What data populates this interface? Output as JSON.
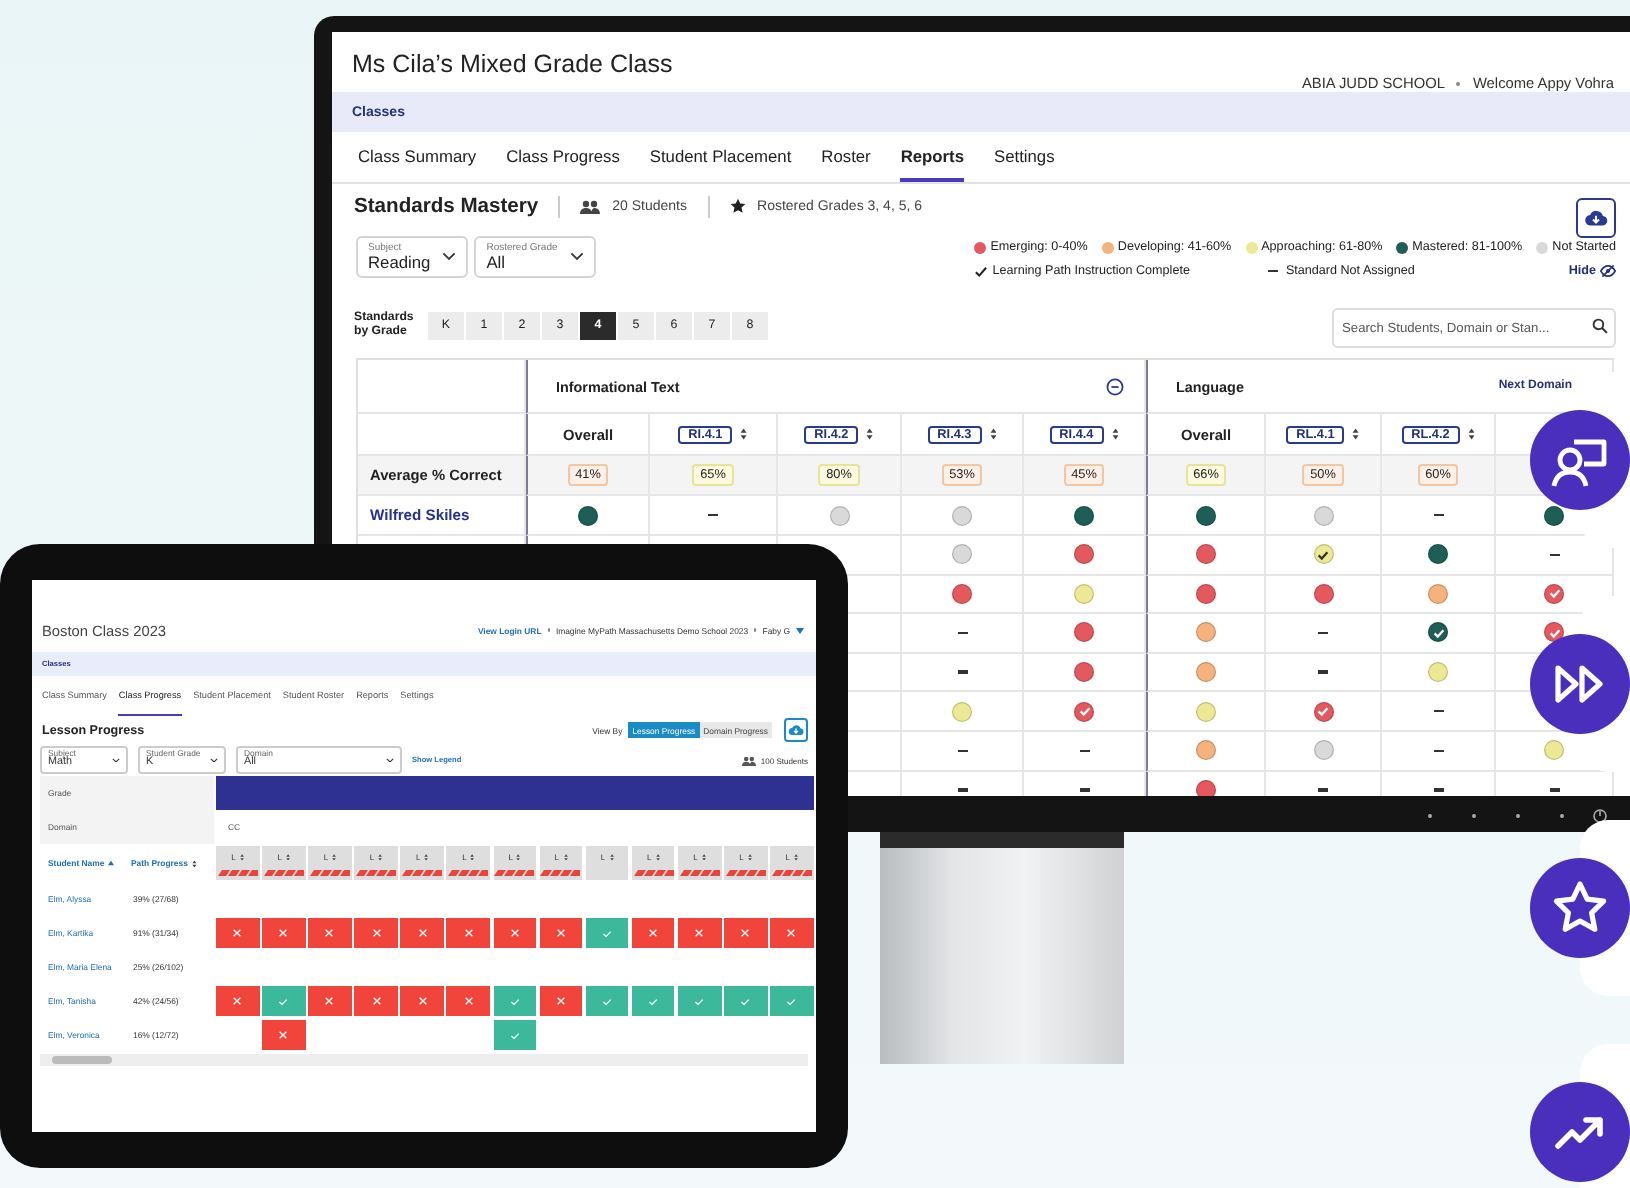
{
  "monitor": {
    "title": "Ms Cila’s Mixed Grade Class",
    "school": "ABIA JUDD SCHOOL",
    "welcome": "Welcome Appy Vohra",
    "breadcrumb": "Classes",
    "tabs": [
      {
        "label": "Class Summary",
        "selected": false
      },
      {
        "label": "Class Progress",
        "selected": false
      },
      {
        "label": "Student Placement",
        "selected": false
      },
      {
        "label": "Roster",
        "selected": false
      },
      {
        "label": "Reports",
        "selected": true
      },
      {
        "label": "Settings",
        "selected": false
      }
    ],
    "report_title": "Standards Mastery",
    "students": "20 Students",
    "rostered": "Rostered Grades 3, 4, 5, 6",
    "filters": [
      {
        "label": "Subject",
        "value": "Reading"
      },
      {
        "label": "Rostered Grade",
        "value": "All"
      }
    ],
    "legend": [
      {
        "label": "Emerging: 0-40%",
        "kind": "emerging"
      },
      {
        "label": "Developing: 41-60%",
        "kind": "developing"
      },
      {
        "label": "Approaching: 61-80%",
        "kind": "approaching"
      },
      {
        "label": "Mastered: 81-100%",
        "kind": "mastered"
      },
      {
        "label": "Not Started",
        "kind": "not_started"
      }
    ],
    "legend_notes": [
      {
        "label": "Learning Path Instruction Complete",
        "kind": "check"
      },
      {
        "label": "Standard Not Assigned",
        "kind": "dash"
      }
    ],
    "hide_link": "Hide",
    "grade_label": "Standards by Grade",
    "grades": [
      {
        "label": "K",
        "selected": false
      },
      {
        "label": "1",
        "selected": false
      },
      {
        "label": "2",
        "selected": false
      },
      {
        "label": "3",
        "selected": false
      },
      {
        "label": "4",
        "selected": true
      },
      {
        "label": "5",
        "selected": false
      },
      {
        "label": "6",
        "selected": false
      },
      {
        "label": "7",
        "selected": false
      },
      {
        "label": "8",
        "selected": false
      }
    ],
    "search": {
      "placeholder": "Search Students, Domain or Stan..."
    },
    "domains": [
      {
        "name": "Informational Text",
        "collapsible": true,
        "columns": [
          {
            "label": "Overall",
            "kind": "overall"
          },
          {
            "label": "RI.4.1",
            "kind": "standard"
          },
          {
            "label": "RI.4.2",
            "kind": "standard"
          },
          {
            "label": "RI.4.3",
            "kind": "standard"
          },
          {
            "label": "RI.4.4",
            "kind": "standard"
          }
        ]
      },
      {
        "name": "Language",
        "collapsible": false,
        "columns": [
          {
            "label": "Overall",
            "kind": "overall"
          },
          {
            "label": "RL.4.1",
            "kind": "standard"
          },
          {
            "label": "RL.4.2",
            "kind": "standard"
          },
          {
            "kind": "standard"
          }
        ]
      }
    ],
    "next_domain": "Next Domain",
    "average": {
      "label": "Average % Correct",
      "values": [
        {
          "text": "41%",
          "kind": "developing"
        },
        {
          "text": "65%",
          "kind": "approaching"
        },
        {
          "text": "80%",
          "kind": "approaching"
        },
        {
          "text": "53%",
          "kind": "developing"
        },
        {
          "text": "45%",
          "kind": "developing"
        },
        {
          "text": "66%",
          "kind": "approaching"
        },
        {
          "text": "50%",
          "kind": "developing"
        },
        {
          "text": "60%",
          "kind": "developing"
        }
      ]
    },
    "rows": [
      {
        "name": "Wilfred Skiles",
        "cells": [
          {
            "kind": "mastered",
            "complete": false
          },
          {
            "kind": "not_assigned"
          },
          {
            "kind": "not_started",
            "complete": false
          },
          {
            "kind": "not_started",
            "complete": false
          },
          {
            "kind": "mastered",
            "complete": false
          },
          {
            "kind": "mastered",
            "complete": false
          },
          {
            "kind": "not_started",
            "complete": false
          },
          {
            "kind": "not_assigned"
          },
          {
            "kind": "mastered",
            "complete": false
          }
        ]
      },
      {
        "cells": [
          {
            "kind": "not_started",
            "complete": false
          },
          {
            "kind": "emerging",
            "complete": false
          },
          {
            "kind": "emerging",
            "complete": false
          },
          {
            "kind": "approaching",
            "complete": true
          },
          {
            "kind": "mastered",
            "complete": false
          },
          {
            "kind": "not_assigned"
          }
        ]
      },
      {
        "cells": [
          {
            "kind": "emerging",
            "complete": false
          },
          {
            "kind": "approaching",
            "complete": false
          },
          {
            "kind": "emerging",
            "complete": false
          },
          {
            "kind": "emerging",
            "complete": false
          },
          {
            "kind": "developing",
            "complete": false
          },
          {
            "kind": "emerging",
            "complete": true
          }
        ]
      },
      {
        "cells": [
          {
            "kind": "not_assigned"
          },
          {
            "kind": "emerging",
            "complete": false
          },
          {
            "kind": "developing",
            "complete": false
          },
          {
            "kind": "not_assigned"
          },
          {
            "kind": "mastered",
            "complete": true
          },
          {
            "kind": "emerging",
            "complete": true
          }
        ]
      },
      {
        "cells": [
          {
            "kind": "not_assigned"
          },
          {
            "kind": "emerging",
            "complete": false
          },
          {
            "kind": "developing",
            "complete": false
          },
          {
            "kind": "not_assigned"
          },
          {
            "kind": "approaching",
            "complete": false
          }
        ]
      },
      {
        "cells": [
          {
            "kind": "approaching",
            "complete": false
          },
          {
            "kind": "emerging",
            "complete": true
          },
          {
            "kind": "approaching",
            "complete": false
          },
          {
            "kind": "emerging",
            "complete": true
          },
          {
            "kind": "not_assigned"
          }
        ]
      },
      {
        "cells": [
          {
            "kind": "not_assigned"
          },
          {
            "kind": "not_assigned"
          },
          {
            "kind": "developing",
            "complete": false
          },
          {
            "kind": "not_started",
            "complete": false
          },
          {
            "kind": "not_assigned"
          },
          {
            "kind": "approaching",
            "complete": false
          }
        ]
      },
      {
        "cells": [
          {
            "kind": "not_assigned"
          },
          {
            "kind": "not_assigned"
          },
          {
            "kind": "emerging",
            "complete": false
          },
          {
            "kind": "not_assigned"
          },
          {
            "kind": "not_assigned"
          },
          {
            "kind": "not_assigned"
          }
        ]
      }
    ]
  },
  "tablet": {
    "title": "Boston Class 2023",
    "login_link": "View Login URL",
    "school": "Imagine MyPath Massachusetts Demo School 2023",
    "user": "Faby G",
    "breadcrumb": "Classes",
    "tabs": [
      {
        "label": "Class Summary",
        "selected": false
      },
      {
        "label": "Class Progress",
        "selected": true
      },
      {
        "label": "Student Placement",
        "selected": false
      },
      {
        "label": "Student Roster",
        "selected": false
      },
      {
        "label": "Reports",
        "selected": false
      },
      {
        "label": "Settings",
        "selected": false
      }
    ],
    "report_title": "Lesson Progress",
    "view_by_label": "View By",
    "view_by": [
      {
        "label": "Lesson Progress",
        "selected": true
      },
      {
        "label": "Domain Progress",
        "selected": false
      }
    ],
    "filters": [
      {
        "label": "Subject",
        "value": "Math"
      },
      {
        "label": "Student Grade",
        "value": "K"
      },
      {
        "label": "Domain",
        "value": "All"
      }
    ],
    "legend_link": "Show Legend",
    "students": "100 Students",
    "grade_label": "Grade",
    "domain_label": "Domain",
    "domain_value": "CC",
    "name_header": "Student Name",
    "progress_header": "Path Progress",
    "lessons": [
      {
        "label": "L",
        "striped": true
      },
      {
        "label": "L",
        "striped": true
      },
      {
        "label": "L",
        "striped": true
      },
      {
        "label": "L",
        "striped": true
      },
      {
        "label": "L",
        "striped": true
      },
      {
        "label": "L",
        "striped": true
      },
      {
        "label": "L",
        "striped": true
      },
      {
        "label": "L",
        "striped": true
      },
      {
        "label": "L",
        "striped": false
      },
      {
        "label": "L",
        "striped": true
      },
      {
        "label": "L",
        "striped": true
      },
      {
        "label": "L",
        "striped": true
      },
      {
        "label": "L",
        "striped": true
      }
    ],
    "student_rows": [
      {
        "name": "Elm, Alyssa",
        "progress": "39% (27/68)"
      },
      {
        "name": "Elm, Kartika",
        "progress": "91% (31/34)",
        "results": [
          {
            "kind": "fail"
          },
          {
            "kind": "fail"
          },
          {
            "kind": "fail"
          },
          {
            "kind": "fail"
          },
          {
            "kind": "fail"
          },
          {
            "kind": "fail"
          },
          {
            "kind": "fail"
          },
          {
            "kind": "fail"
          },
          {
            "kind": "pass"
          },
          {
            "kind": "fail"
          },
          {
            "kind": "fail"
          },
          {
            "kind": "fail"
          },
          {
            "kind": "fail"
          }
        ]
      },
      {
        "name": "Elm, Maria Elena",
        "progress": "25% (26/102)"
      },
      {
        "name": "Elm, Tanisha",
        "progress": "42% (24/56)",
        "results": [
          {
            "kind": "fail"
          },
          {
            "kind": "pass"
          },
          {
            "kind": "fail"
          },
          {
            "kind": "fail"
          },
          {
            "kind": "fail"
          },
          {
            "kind": "fail"
          },
          {
            "kind": "pass"
          },
          {
            "kind": "fail"
          },
          {
            "kind": "pass"
          },
          {
            "kind": "pass"
          },
          {
            "kind": "pass"
          },
          {
            "kind": "pass"
          },
          {
            "kind": "pass"
          }
        ]
      },
      {
        "name": "Elm, Veronica",
        "progress": "16% (12/72)",
        "results": [
          {
            "kind": "empty"
          },
          {
            "kind": "fail"
          },
          {
            "kind": "empty"
          },
          {
            "kind": "empty"
          },
          {
            "kind": "empty"
          },
          {
            "kind": "empty"
          },
          {
            "kind": "pass"
          }
        ]
      }
    ]
  },
  "rail": [
    {
      "kind": "teacher"
    },
    {
      "kind": "forward"
    },
    {
      "kind": "star"
    },
    {
      "kind": "trend"
    }
  ]
}
